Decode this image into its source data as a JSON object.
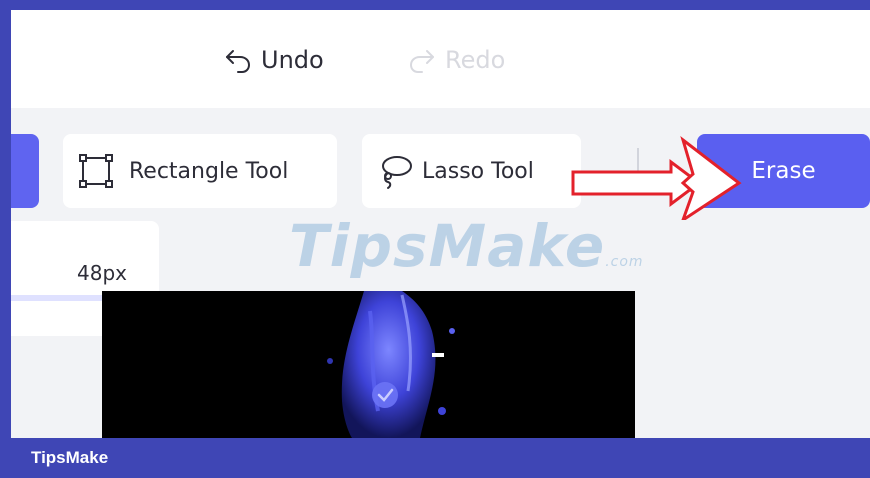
{
  "toolbar": {
    "undo_label": "Undo",
    "redo_label": "Redo"
  },
  "tools": {
    "rectangle_label": "Rectangle Tool",
    "lasso_label": "Lasso Tool",
    "erase_label": "Erase"
  },
  "brush": {
    "size_label": "48px"
  },
  "watermark": {
    "text": "TipsMake",
    "suffix": ".com"
  },
  "footer": {
    "brand": "TipsMake"
  },
  "colors": {
    "accent": "#5a5ff0",
    "frame_border": "#3f46b5",
    "annotation_red": "#e3212b"
  },
  "icons": {
    "undo": "undo-arrow-icon",
    "redo": "redo-arrow-icon",
    "rectangle": "rectangle-select-icon",
    "lasso": "lasso-icon"
  }
}
